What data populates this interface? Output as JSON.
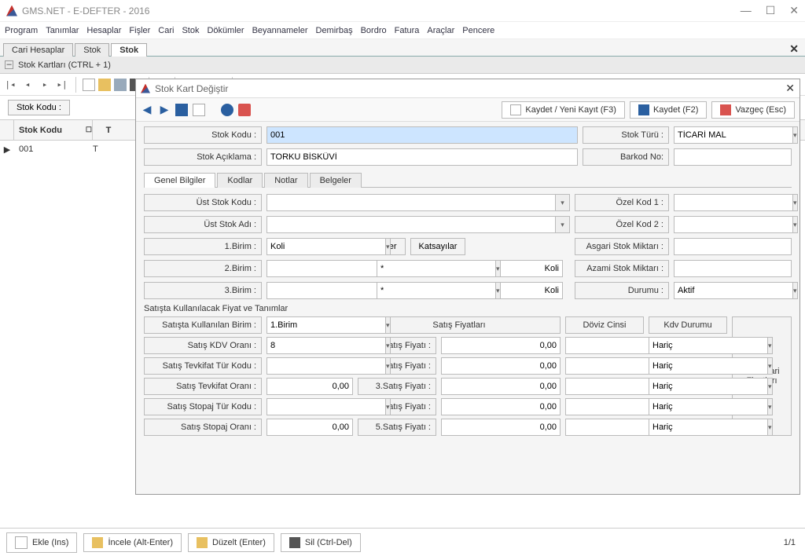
{
  "app": {
    "title": "GMS.NET - E-DEFTER - 2016"
  },
  "menu": [
    "Program",
    "Tanımlar",
    "Hesaplar",
    "Fişler",
    "Cari",
    "Stok",
    "Dökümler",
    "Beyannameler",
    "Demirbaş",
    "Bordro",
    "Fatura",
    "Araçlar",
    "Pencere"
  ],
  "tabs": [
    {
      "label": "Cari Hesaplar",
      "active": false
    },
    {
      "label": "Stok",
      "active": false
    },
    {
      "label": "Stok",
      "active": true
    }
  ],
  "subheader": "Stok Kartları  (CTRL + 1)",
  "search": {
    "label": "Stok Kodu :"
  },
  "grid": {
    "headers": [
      "Stok Kodu",
      "T"
    ],
    "row": {
      "kod": "001",
      "t": "T"
    }
  },
  "bottom": {
    "ekle": "Ekle (Ins)",
    "incele": "İncele (Alt-Enter)",
    "duzelt": "Düzelt (Enter)",
    "sil": "Sil (Ctrl-Del)",
    "page": "1/1"
  },
  "modal": {
    "title": "Stok Kart Değiştir",
    "toolbar": {
      "kaydetYeni": "Kaydet / Yeni Kayıt (F3)",
      "kaydet": "Kaydet (F2)",
      "vazgec": "Vazgeç (Esc)"
    },
    "top": {
      "kodLbl": "Stok Kodu :",
      "kod": "001",
      "turLbl": "Stok Türü :",
      "tur": "TİCARİ MAL",
      "aciklamaLbl": "Stok Açıklama :",
      "aciklama": "TORKU BİSKÜVİ",
      "barkodLbl": "Barkod No:",
      "barkod": ""
    },
    "subtabs": [
      "Genel Bilgiler",
      "Kodlar",
      "Notlar",
      "Belgeler"
    ],
    "genel": {
      "ustKod": "Üst Stok Kodu :",
      "ustAd": "Üst Stok Adı :",
      "b1": "1.Birim :",
      "b1v": "Koli",
      "b2": "2.Birim :",
      "b2v": "",
      "b3": "3.Birim :",
      "b3v": "",
      "islemler": "İşlemler",
      "katsayilar": "Katsayılar",
      "eq": "=",
      "star": "*",
      "koli": "Koli",
      "ozel1": "Özel Kod 1 :",
      "ozel2": "Özel Kod 2 :",
      "asgari": "Asgari Stok Miktarı :",
      "azami": "Azami Stok Miktarı :",
      "durum": "Durumu :",
      "durumv": "Aktif"
    },
    "sales": {
      "title": "Satışta Kullanılacak Fiyat ve Tanımlar",
      "birimLbl": "Satışta Kullanılan Birim :",
      "birimv": "1.Birim",
      "kdvLbl": "Satış KDV Oranı :",
      "kdvv": "8",
      "tevkifatTurLbl": "Satış Tevkifat Tür Kodu :",
      "tevkifatOranLbl": "Satış Tevkifat Oranı :",
      "tevkifatOranv": "0,00",
      "stopajTurLbl": "Satış Stopaj Tür Kodu :",
      "stopajOranLbl": "Satış Stopaj Oranı :",
      "stopajOranv": "0,00",
      "fiyatHdr": "Satış Fiyatları",
      "dovizHdr": "Döviz Cinsi",
      "kdvDurHdr": "Kdv Durumu",
      "f1": "1.Satış Fiyatı :",
      "f2": "2.Satış Fiyatı :",
      "f3": "3.Satış Fiyatı :",
      "f4": "4.Satış Fiyatı :",
      "f5": "5.Satış Fiyatı :",
      "fval": "0,00",
      "haric": "Hariç",
      "stokCari": "Stok Cari Fiyatları"
    }
  }
}
